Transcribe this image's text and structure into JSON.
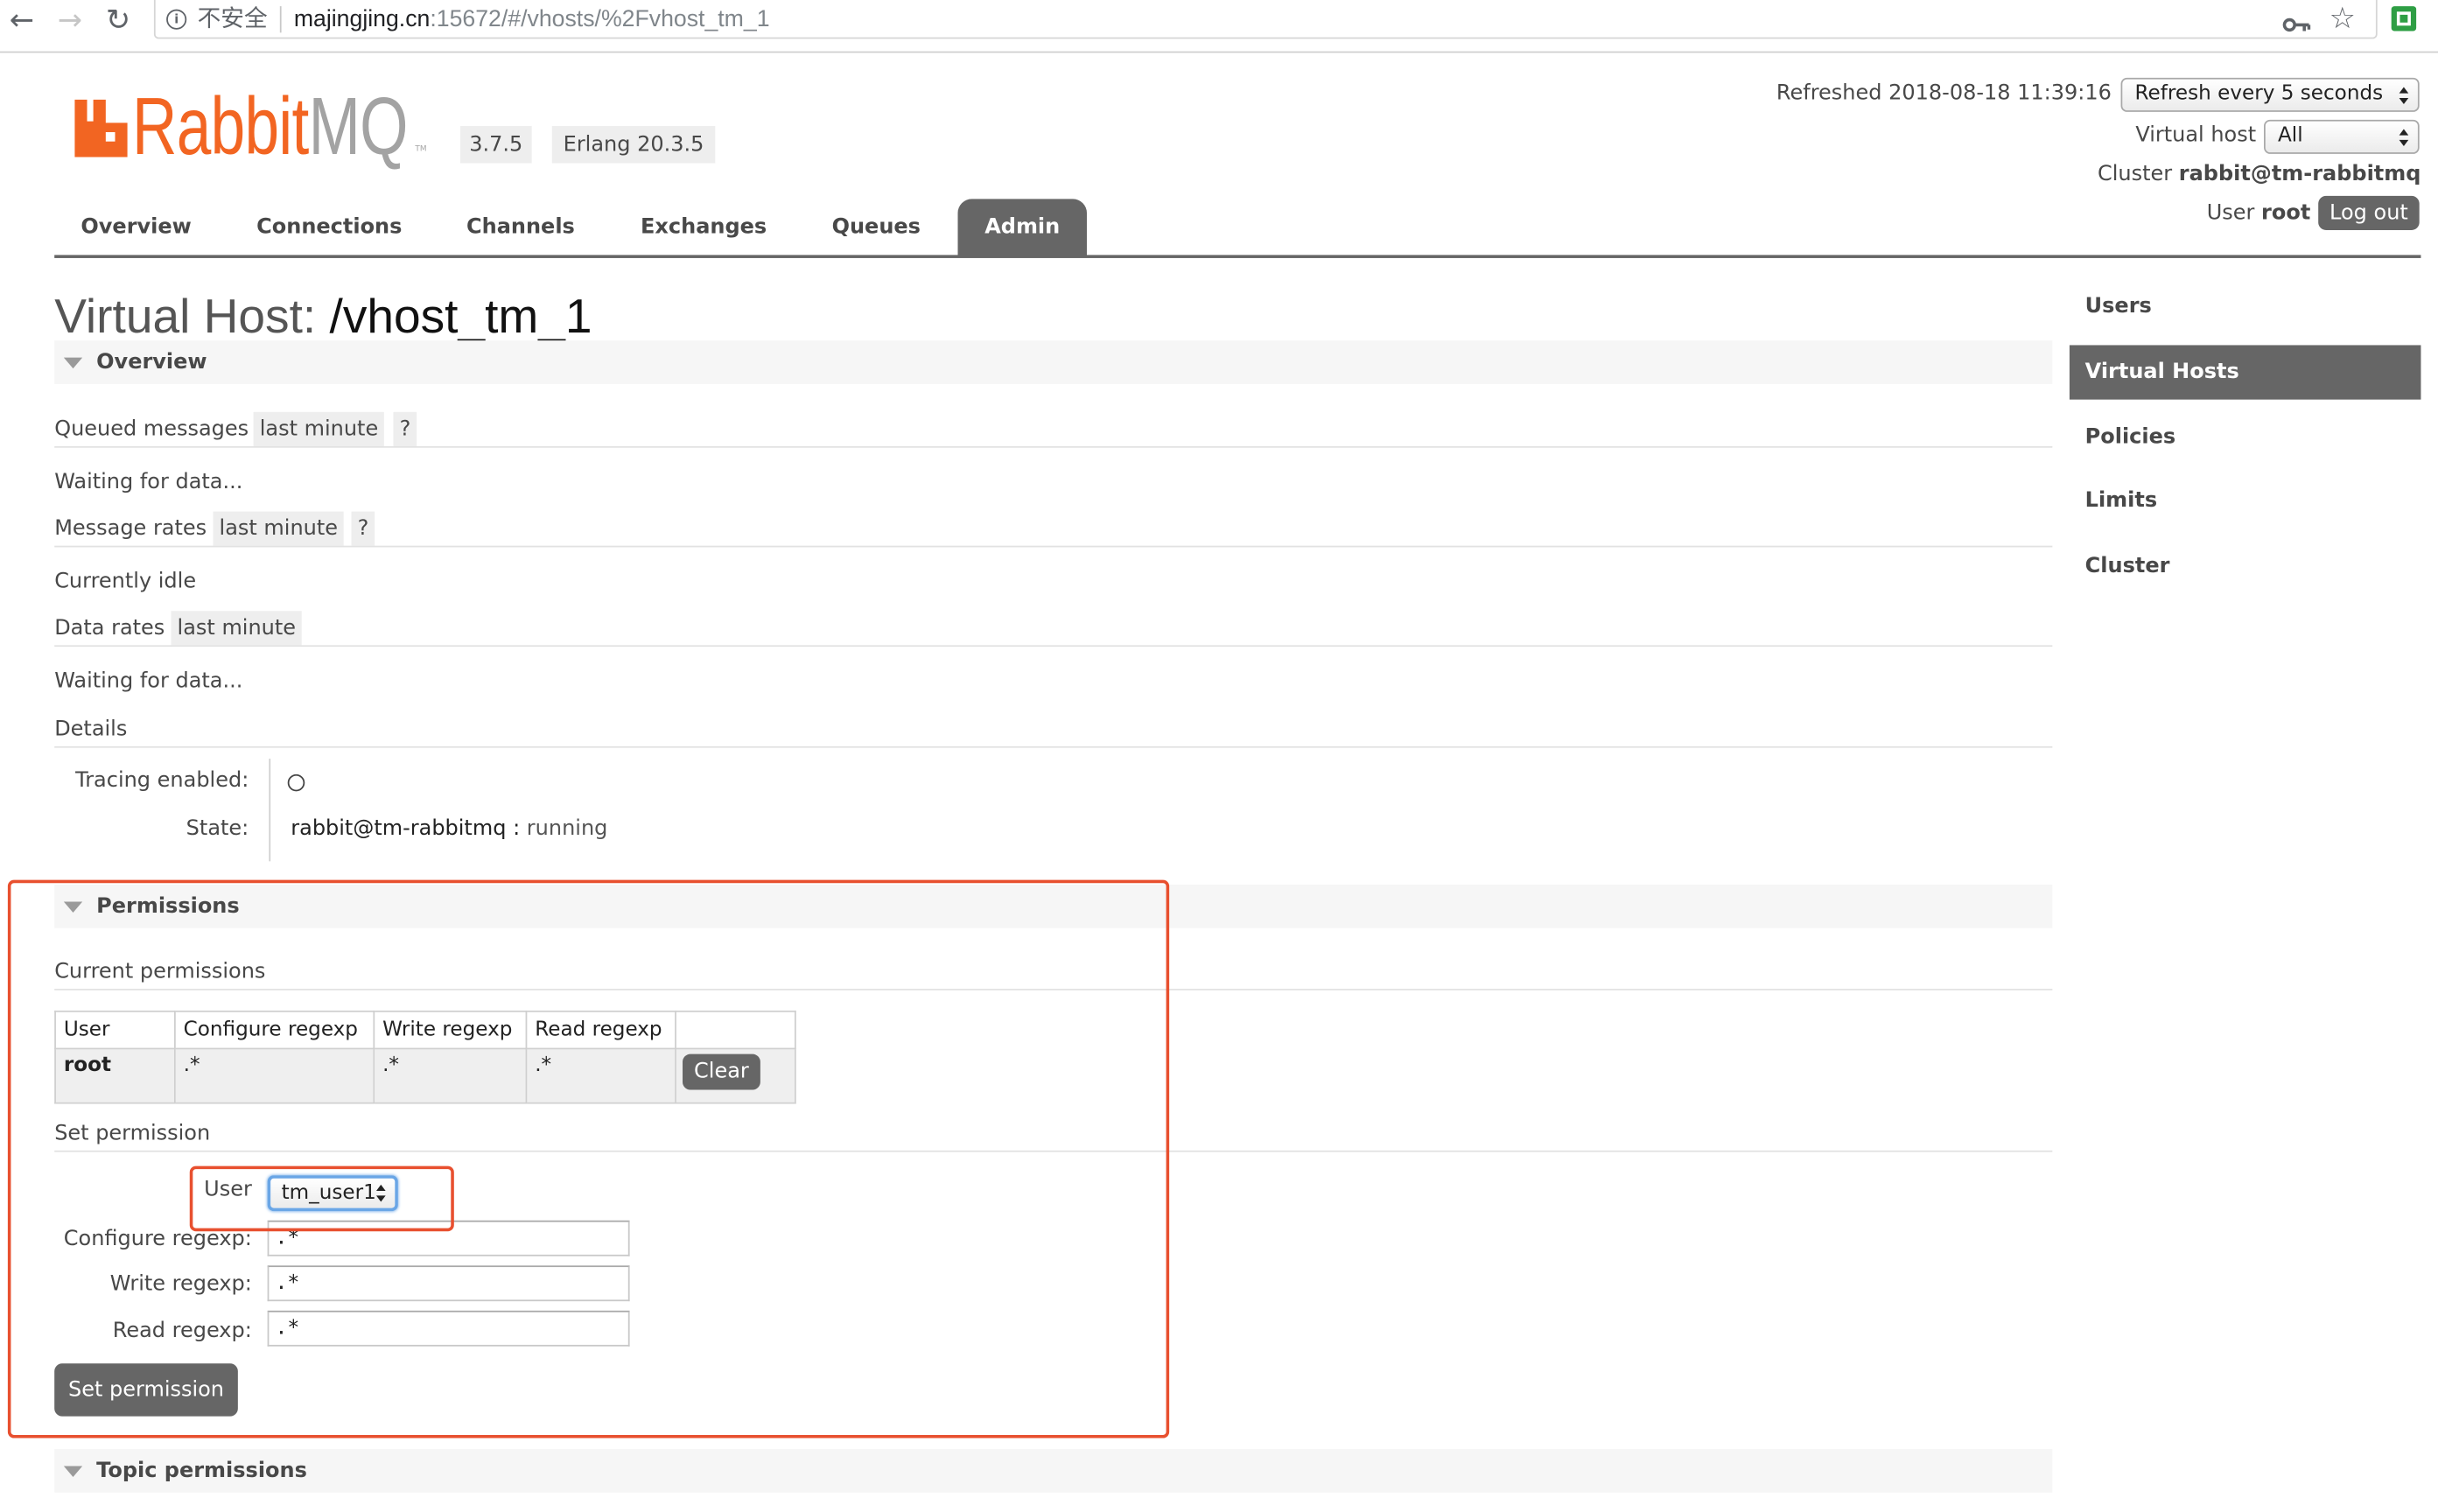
{
  "browser": {
    "security_label": "不安全",
    "url_domain": "majingjing.cn",
    "url_path": ":15672/#/vhosts/%2Fvhost_tm_1"
  },
  "header": {
    "logo_rabbit": "Rabbit",
    "logo_mq": "MQ",
    "logo_tm": "TM",
    "version": "3.7.5",
    "erlang": "Erlang 20.3.5",
    "refreshed": "Refreshed 2018-08-18 11:39:16",
    "refresh_interval": "Refresh every 5 seconds",
    "vhost_label": "Virtual host",
    "vhost_value": "All",
    "cluster_label": "Cluster",
    "cluster_name": "rabbit@tm-rabbitmq",
    "user_label": "User",
    "user_name": "root",
    "logout": "Log out"
  },
  "tabs": [
    {
      "label": "Overview",
      "active": false
    },
    {
      "label": "Connections",
      "active": false
    },
    {
      "label": "Channels",
      "active": false
    },
    {
      "label": "Exchanges",
      "active": false
    },
    {
      "label": "Queues",
      "active": false
    },
    {
      "label": "Admin",
      "active": true
    }
  ],
  "page_title": {
    "prefix": "Virtual Host:",
    "name": "/vhost_tm_1"
  },
  "sidebar": {
    "items": [
      {
        "label": "Users",
        "active": false
      },
      {
        "label": "Virtual Hosts",
        "active": true
      },
      {
        "label": "Policies",
        "active": false
      },
      {
        "label": "Limits",
        "active": false
      },
      {
        "label": "Cluster",
        "active": false
      }
    ]
  },
  "overview": {
    "section_title": "Overview",
    "queued_messages": {
      "label": "Queued messages",
      "range": "last minute",
      "help": "?"
    },
    "queued_status": "Waiting for data...",
    "message_rates": {
      "label": "Message rates",
      "range": "last minute",
      "help": "?"
    },
    "message_status": "Currently idle",
    "data_rates": {
      "label": "Data rates",
      "range": "last minute"
    },
    "data_status": "Waiting for data...",
    "details_title": "Details",
    "tracing_label": "Tracing enabled:",
    "tracing_enabled": false,
    "state_label": "State:",
    "state_node": "rabbit@tm-rabbitmq",
    "state_separator": ":",
    "state_value": "running"
  },
  "permissions": {
    "section_title": "Permissions",
    "current_title": "Current permissions",
    "columns": [
      "User",
      "Configure regexp",
      "Write regexp",
      "Read regexp"
    ],
    "rows": [
      {
        "user": "root",
        "configure": ".*",
        "write": ".*",
        "read": ".*",
        "action": "Clear"
      }
    ],
    "set_title": "Set permission",
    "user_label": "User",
    "user_value": "tm_user1",
    "configure_label": "Configure regexp:",
    "configure_value": ".*",
    "write_label": "Write regexp:",
    "write_value": ".*",
    "read_label": "Read regexp:",
    "read_value": ".*",
    "submit": "Set permission"
  },
  "topic_permissions": {
    "section_title": "Topic permissions"
  },
  "icons": {
    "back": "arrow-left-icon",
    "forward": "arrow-right-icon",
    "reload": "reload-icon",
    "info": "info-icon",
    "key": "key-icon",
    "bookmark": "star-icon",
    "extension": "extension-icon",
    "logo": "rabbitmq-logo-icon",
    "section_toggle": "triangle-down-icon",
    "select_arrows": "updown-arrows-icon"
  },
  "colors": {
    "brand_orange": "#f26522",
    "active_tab": "#666666",
    "button": "#666666",
    "annotation_red": "#e8502f",
    "focus_blue": "#6aa6e6"
  }
}
